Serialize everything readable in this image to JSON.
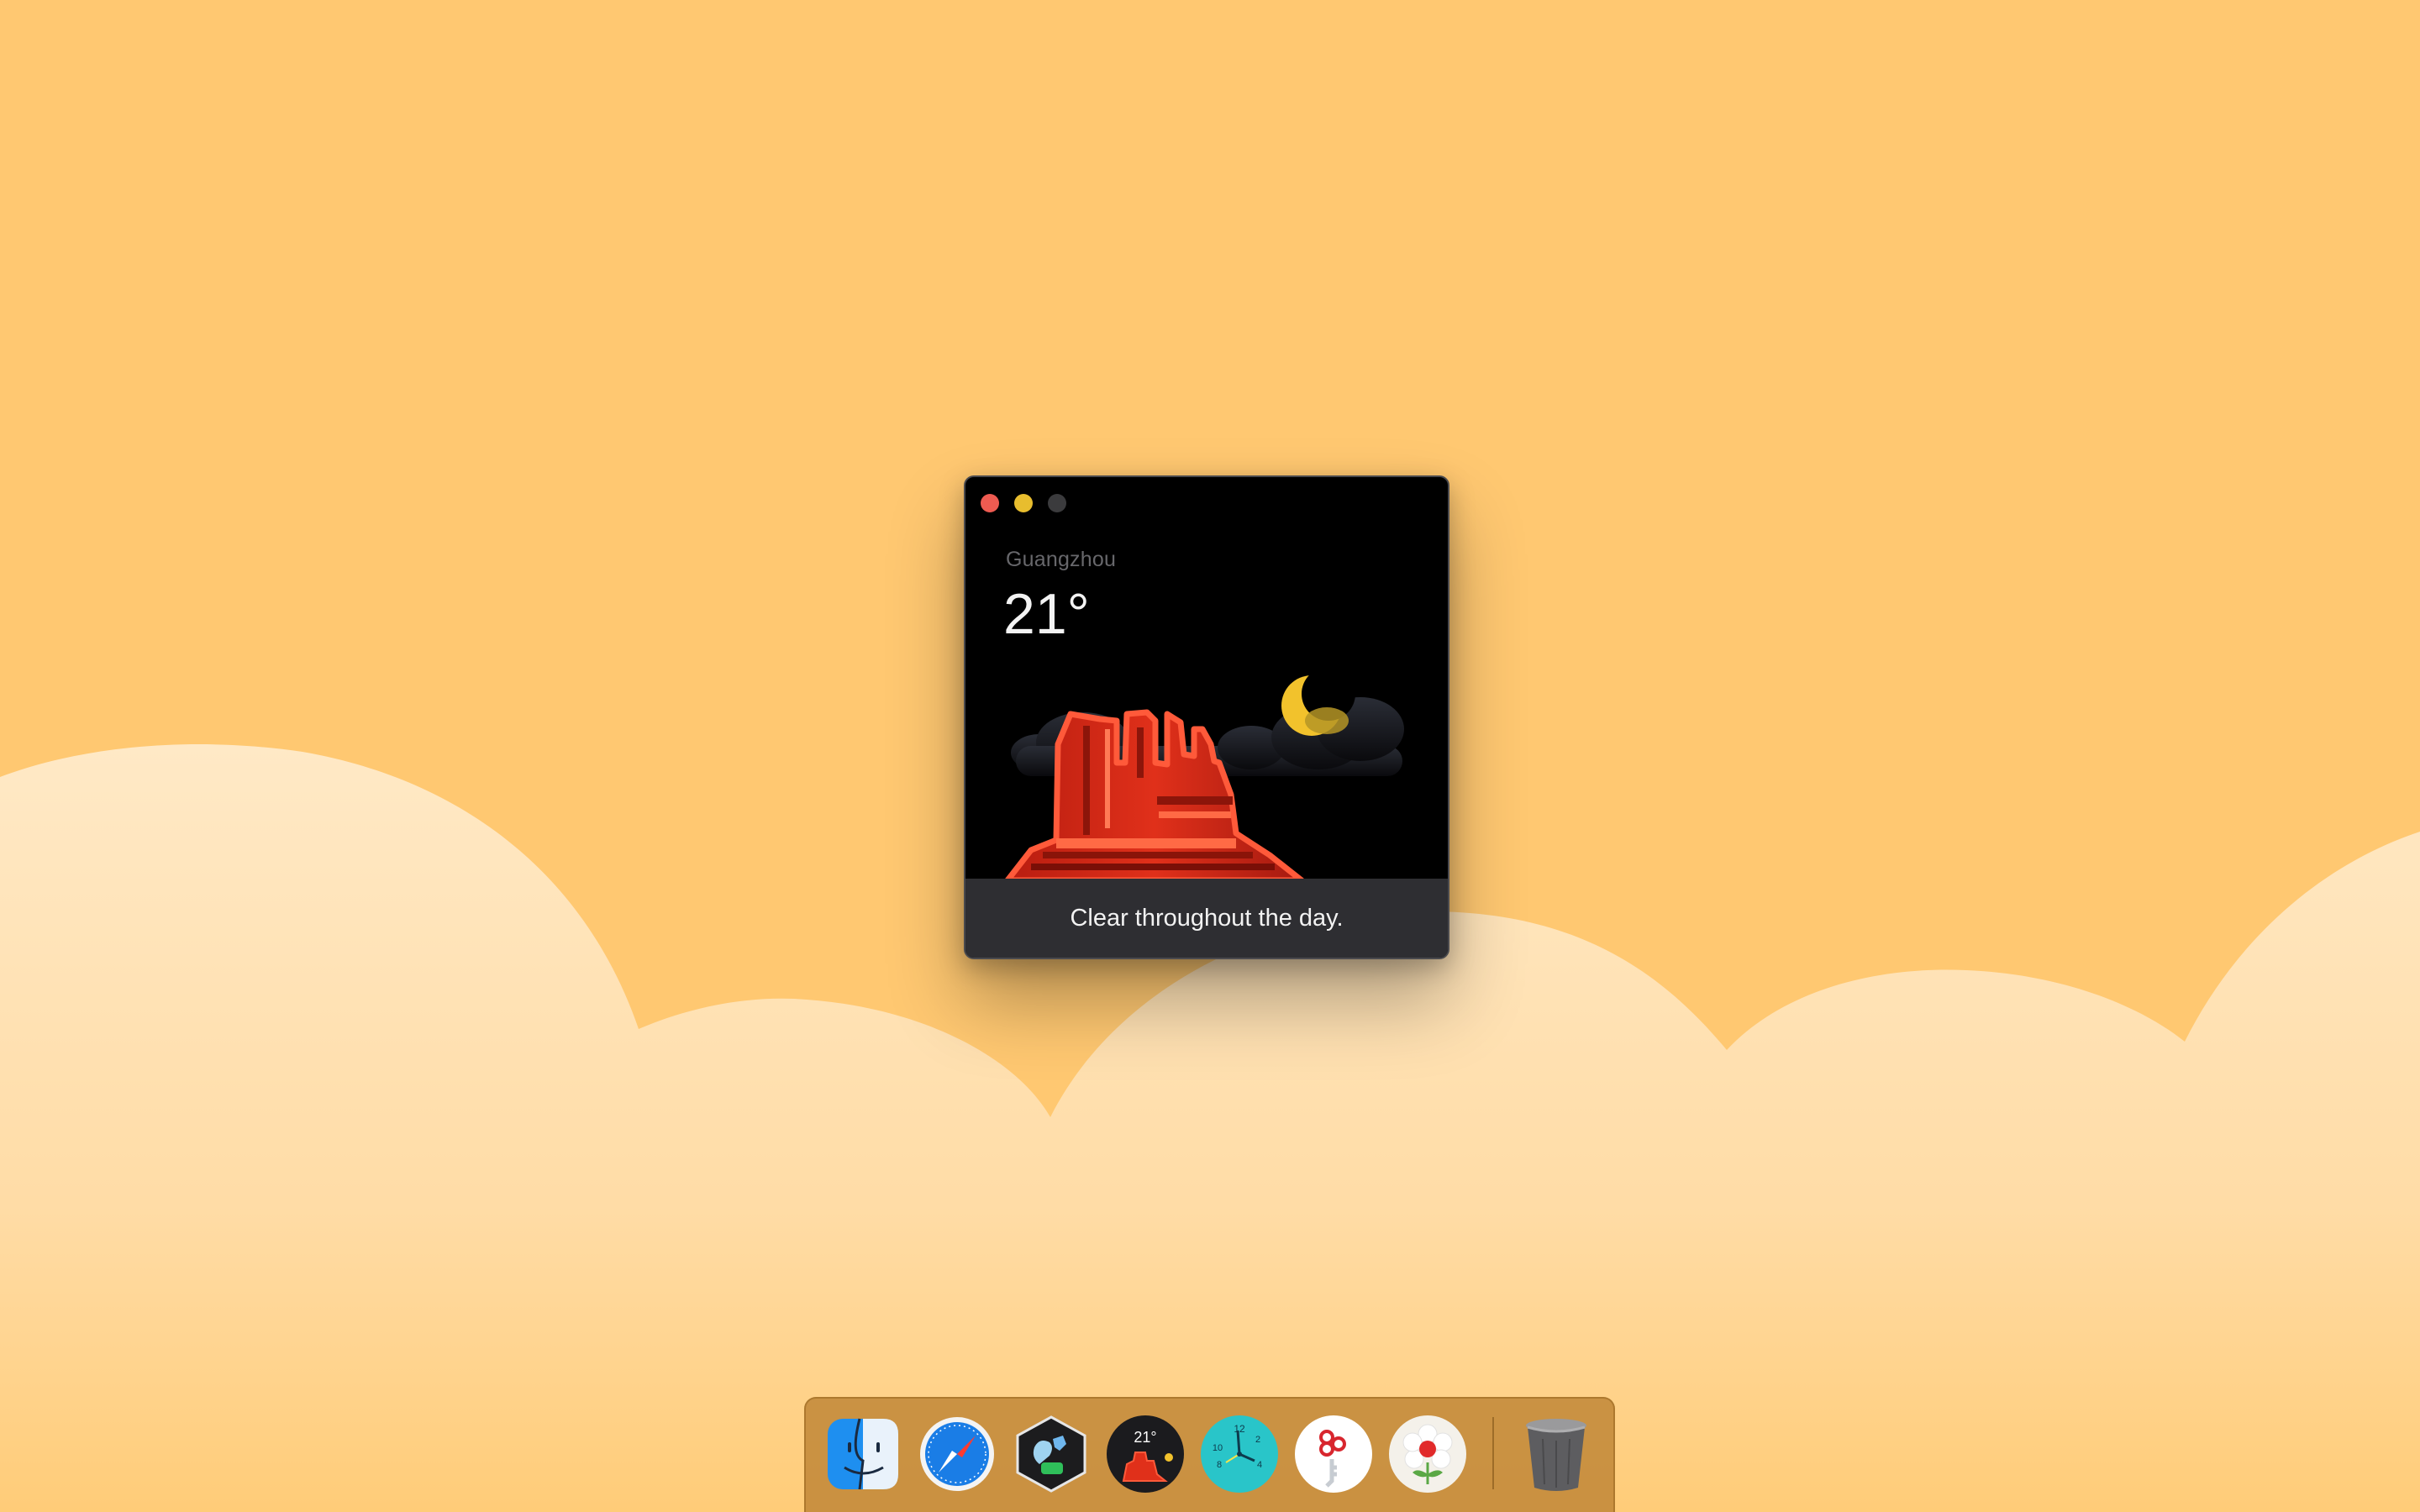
{
  "window": {
    "city": "Guangzhou",
    "temperature": "21°",
    "condition": "Clear throughout the day."
  },
  "dock": {
    "items": [
      {
        "name": "finder-icon"
      },
      {
        "name": "safari-icon"
      },
      {
        "name": "app-icon"
      },
      {
        "name": "weather-app-icon",
        "badge": "21°"
      },
      {
        "name": "clock-app-icon",
        "numerals": [
          "12",
          "2",
          "4",
          "8",
          "10"
        ]
      },
      {
        "name": "keychain-icon"
      },
      {
        "name": "flower-app-icon"
      },
      {
        "name": "trash-icon"
      }
    ]
  },
  "colors": {
    "wallpaper": "#ffc871",
    "cloud_light": "#ffe8c1",
    "window_bg": "#000000",
    "condition_bar": "#2e2e32",
    "close": "#ee5b51",
    "minimize": "#e8bd2e",
    "zoom": "#3b3b3d"
  }
}
